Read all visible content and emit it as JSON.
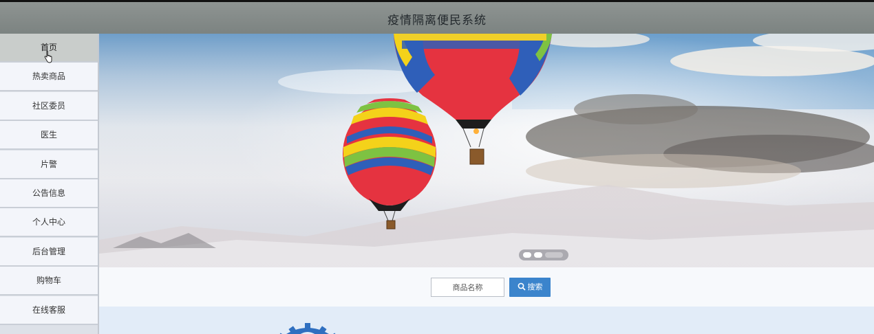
{
  "header": {
    "title": "疫情隔离便民系统"
  },
  "sidebar": {
    "items": [
      {
        "label": "首页"
      },
      {
        "label": "热卖商品"
      },
      {
        "label": "社区委员"
      },
      {
        "label": "医生"
      },
      {
        "label": "片警"
      },
      {
        "label": "公告信息"
      },
      {
        "label": "个人中心"
      },
      {
        "label": "后台管理"
      },
      {
        "label": "购物车"
      },
      {
        "label": "在线客服"
      }
    ]
  },
  "search": {
    "placeholder": "商品名称",
    "button_label": "搜索"
  },
  "colors": {
    "header_bg": "#7c8381",
    "accent": "#3b84cc",
    "sidebar_bg": "#f3f5fa"
  }
}
